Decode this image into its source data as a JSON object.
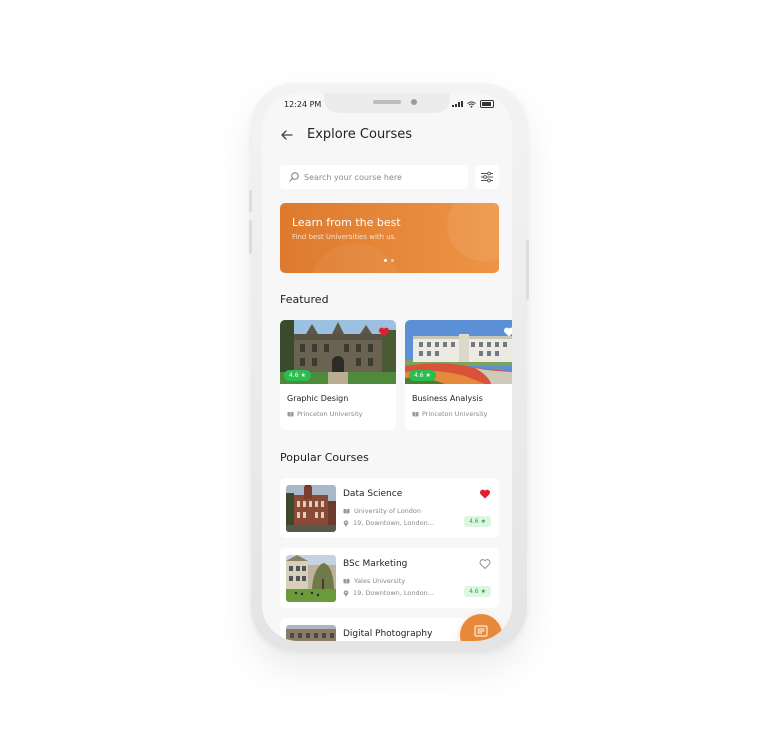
{
  "status_bar": {
    "time": "12:24 PM"
  },
  "header": {
    "title": "Explore Courses"
  },
  "search": {
    "placeholder": "Search your course here"
  },
  "banner": {
    "title": "Learn from the best",
    "subtitle": "Find best Universities with us.",
    "slide_count": 2,
    "active_slide": 1
  },
  "featured": {
    "title": "Featured",
    "cards": [
      {
        "name": "Graphic Design",
        "university": "Princeton University",
        "rating": "4.6",
        "favorited": true
      },
      {
        "name": "Business Analysis",
        "university": "Princeton University",
        "rating": "4.6",
        "favorited": false
      }
    ]
  },
  "popular": {
    "title": "Popular Courses",
    "courses": [
      {
        "name": "Data Science",
        "university": "University of London",
        "location": "19, Downtown, London...",
        "rating": "4.6",
        "favorited": true
      },
      {
        "name": "BSc Marketing",
        "university": "Yales University",
        "location": "19, Downtown, London...",
        "rating": "4.6",
        "favorited": false
      },
      {
        "name": "Digital Photography"
      }
    ]
  },
  "colors": {
    "accent": "#e8883a",
    "rating_green": "#2bbd4f",
    "favorite_red": "#e21d2f"
  },
  "icons": [
    "back-arrow-icon",
    "search-icon",
    "filter-icon",
    "heart-icon",
    "star-icon",
    "book-icon",
    "location-pin-icon",
    "list-icon"
  ]
}
